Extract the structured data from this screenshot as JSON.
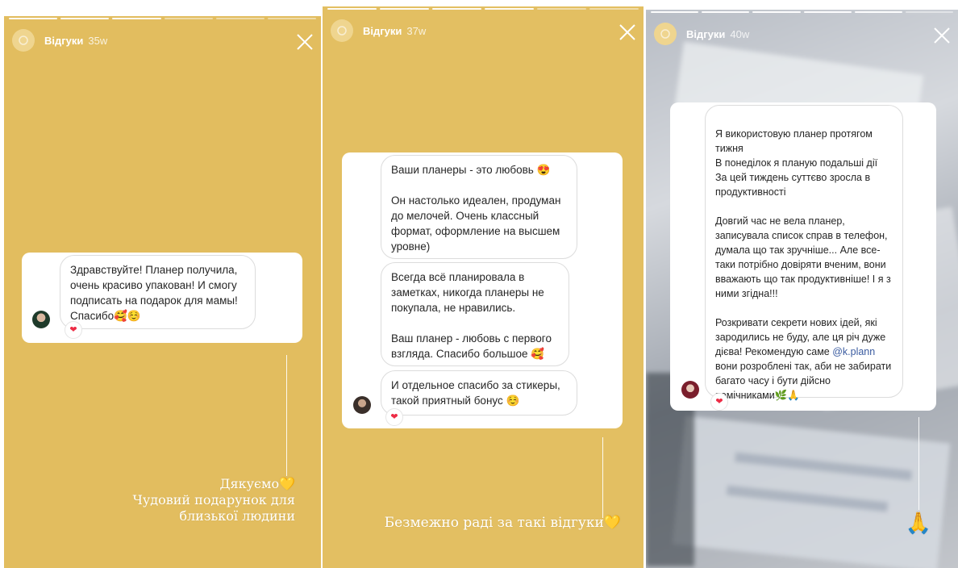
{
  "stories": [
    {
      "account": "Відгуки",
      "time": "35w",
      "messages": [
        {
          "text": "Здравствуйте! Планер получила, очень красиво упакован! И смогу подписать на подарок для мамы! Спасибо🥰☺️"
        }
      ],
      "caption_lines": [
        "Дякуємо💛",
        "Чудовий подарунок для",
        "близької людини"
      ]
    },
    {
      "account": "Відгуки",
      "time": "37w",
      "messages": [
        {
          "text": "Ваши планеры - это любовь 😍\n\nОн настолько идеален, продуман до мелочей. Очень классный формат, оформление на высшем уровне)"
        },
        {
          "text": "Всегда всё планировала в заметках, никогда планеры не покупала, не нравились.\n\nВаш планер - любовь с первого взгляда. Спасибо большое 🥰"
        },
        {
          "text": "И отдельное спасибо за стикеры, такой приятный бонус ☺️"
        }
      ],
      "caption_lines": [
        "Безмежно раді за такі відгуки💛"
      ]
    },
    {
      "account": "Відгуки",
      "time": "40w",
      "messages": [
        {
          "text": "Я використовую планер протягом тижня\nВ понеділок я планую  подальші дії\nЗа цей тиждень суттєво зросла в продуктивності\n\nДовгий час не вела планер, записувала список справ в телефон, думала що так зручніше... Але все-таки потрібно довіряти вченим, вони вважають що так продуктивніше! І я з ними згідна!!!\n\nРозкривати секрети нових ідей, які зародились не буду, але ця річ дуже дієва! Рекомендую саме @k.plann вони розроблені так, аби не забирати багато часу і бути дійсно помічниками🌿🙏"
        }
      ],
      "caption_lines": [
        "🙏"
      ]
    }
  ],
  "colors": {
    "story_bg": "#e2bd5f",
    "heart": "#ed2b45",
    "mention": "#3a5ba0"
  },
  "icons": {
    "close": "close-icon",
    "heart": "heart-icon"
  }
}
